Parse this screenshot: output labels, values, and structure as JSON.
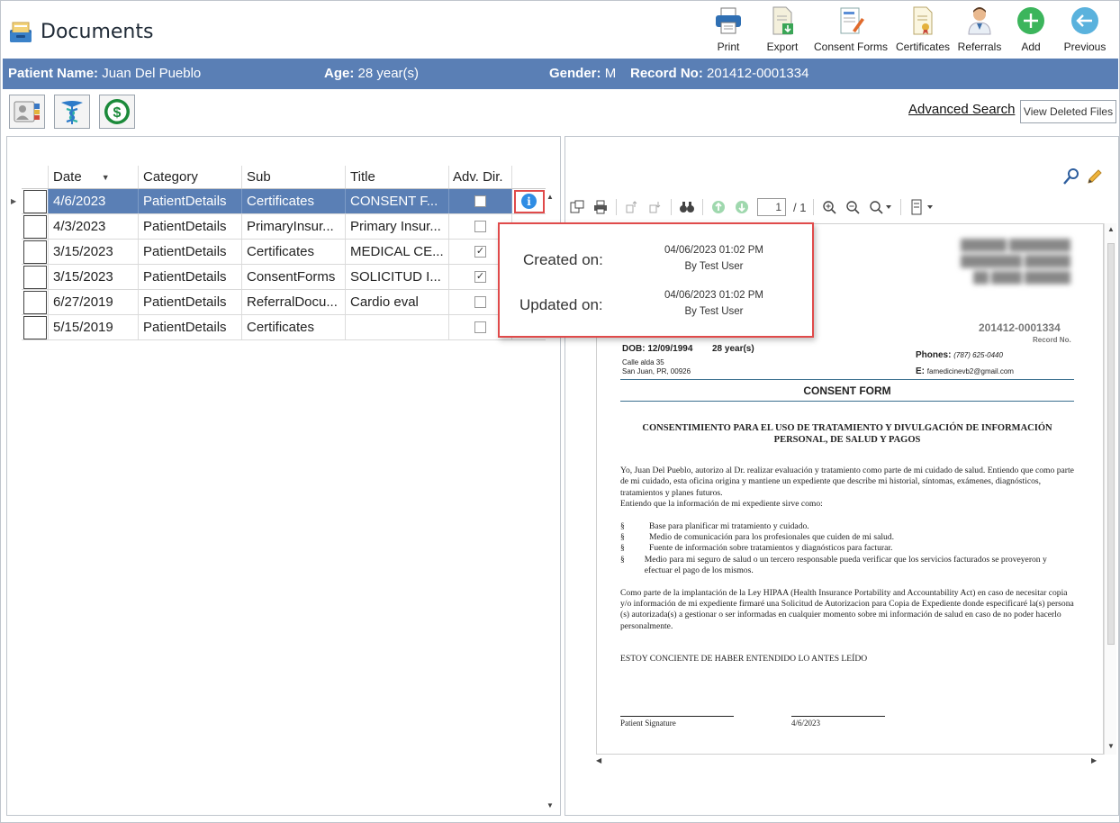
{
  "app": {
    "title": "Documents"
  },
  "toolbar": {
    "print": "Print",
    "export": "Export",
    "consent_forms": "Consent Forms",
    "certificates": "Certificates",
    "referrals": "Referrals",
    "add": "Add",
    "previous": "Previous"
  },
  "patient": {
    "name_label": "Patient Name:",
    "name": "Juan Del Pueblo",
    "age_label": "Age:",
    "age": "28 year(s)",
    "gender_label": "Gender:",
    "gender": "M",
    "record_label": "Record No:",
    "record": "201412-0001334"
  },
  "links": {
    "advanced_search": "Advanced Search",
    "view_deleted": "View Deleted Files"
  },
  "grid": {
    "headers": {
      "date": "Date",
      "category": "Category",
      "sub": "Sub",
      "title": "Title",
      "adv_dir": "Adv. Dir."
    },
    "rows": [
      {
        "date": "4/6/2023",
        "category": "PatientDetails",
        "sub": "Certificates",
        "title": "CONSENT F...",
        "adv_dir": false
      },
      {
        "date": "4/3/2023",
        "category": "PatientDetails",
        "sub": "PrimaryInsur...",
        "title": "Primary Insur...",
        "adv_dir": false
      },
      {
        "date": "3/15/2023",
        "category": "PatientDetails",
        "sub": "Certificates",
        "title": "MEDICAL CE...",
        "adv_dir": true
      },
      {
        "date": "3/15/2023",
        "category": "PatientDetails",
        "sub": "ConsentForms",
        "title": "SOLICITUD I...",
        "adv_dir": true
      },
      {
        "date": "6/27/2019",
        "category": "PatientDetails",
        "sub": "ReferralDocu...",
        "title": "Cardio eval",
        "adv_dir": false
      },
      {
        "date": "5/15/2019",
        "category": "PatientDetails",
        "sub": "Certificates",
        "title": "",
        "adv_dir": false
      }
    ],
    "selected_index": 0
  },
  "popup": {
    "created_label": "Created on:",
    "created_date": "04/06/2023 01:02 PM",
    "created_by": "By Test User",
    "updated_label": "Updated on:",
    "updated_date": "04/06/2023 01:02 PM",
    "updated_by": "By Test User"
  },
  "viewer": {
    "page_current": "1",
    "page_total": "/ 1"
  },
  "document": {
    "record_no": "201412-0001334",
    "record_label": "Record No.",
    "dob": "DOB: 12/09/1994",
    "age": "28 year(s)",
    "address_line1": "Calle alda 35",
    "address_line2": "San Juan, PR, 00926",
    "phones_label": "Phones:",
    "phones": "(787) 625-0440",
    "email_label": "E:",
    "email": "famedicinevb2@gmail.com",
    "form_title": "CONSENT FORM",
    "heading_line1": "CONSENTIMIENTO PARA EL USO DE TRATAMIENTO Y DIVULGACIÓN DE INFORMACIÓN",
    "heading_line2": "PERSONAL, DE SALUD Y PAGOS",
    "para1": "Yo, Juan Del Pueblo, autorizo al Dr.                                     realizar evaluación y tratamiento como parte de mi cuidado de salud.  Entiendo que como parte de mi cuidado, esta oficina origina y mantiene un expediente que describe mi historial, síntomas, exámenes, diagnósticos, tratamientos y planes futuros.",
    "para1b": "Entiendo que la información de mi expediente sirve como:",
    "bullet_mark": "§",
    "bullets": [
      "Base para planificar mi tratamiento y cuidado.",
      "Medio de comunicación para los profesionales que cuiden de mi salud.",
      "Fuente de información sobre tratamientos y diagnósticos para facturar.",
      "Medio para mi seguro de salud o un tercero responsable pueda verificar que los servicios facturados se proveyeron y efectuar el pago de los mismos."
    ],
    "para2": "Como parte de la implantación de la Ley HIPAA (Health Insurance Portability and Accountability Act) en caso de necesitar copia y/o información de mi expediente firmaré una Solicitud de Autorizacion para Copia de Expediente donde especificaré la(s) persona (s) autorizada(s) a gestionar o ser informadas en cualquier momento sobre mi información de salud en caso de no poder hacerlo personalmente.",
    "para3": "ESTOY CONCIENTE DE HABER ENTENDIDO LO ANTES LEÍDO",
    "signature_label": "Patient Signature",
    "signature_date": "4/6/2023"
  }
}
